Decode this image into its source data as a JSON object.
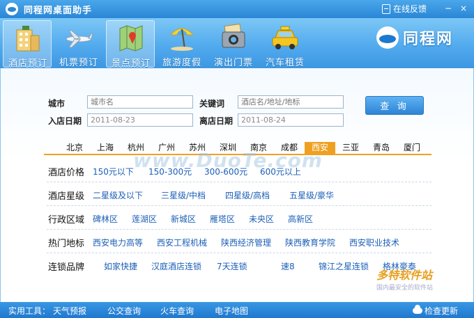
{
  "titlebar": {
    "title": "同程网桌面助手",
    "feedback": "在线反馈",
    "minimize": "−",
    "close": "×"
  },
  "toolbar": {
    "items": [
      {
        "label": "酒店预订",
        "icon": "hotel-icon",
        "active": true
      },
      {
        "label": "机票预订",
        "icon": "airplane-icon",
        "active": false
      },
      {
        "label": "景点预订",
        "icon": "map-icon",
        "active": false
      },
      {
        "label": "旅游度假",
        "icon": "beach-umbrella-icon",
        "active": false
      },
      {
        "label": "演出门票",
        "icon": "camera-ticket-icon",
        "active": false
      },
      {
        "label": "汽车租赁",
        "icon": "taxi-icon",
        "active": false
      }
    ],
    "brand": "同程网"
  },
  "search": {
    "city_label": "城市",
    "city_placeholder": "城市名",
    "keyword_label": "关键词",
    "keyword_placeholder": "酒店名/地址/地标",
    "checkin_label": "入店日期",
    "checkin_value": "2011-08-23",
    "checkout_label": "离店日期",
    "checkout_value": "2011-08-24",
    "button": "查 询"
  },
  "cities": [
    "北京",
    "上海",
    "杭州",
    "广州",
    "苏州",
    "深圳",
    "南京",
    "成都",
    "西安",
    "三亚",
    "青岛",
    "厦门"
  ],
  "active_city": "西安",
  "filters": [
    {
      "title": "酒店价格",
      "options": [
        "150元以下",
        "150-300元",
        "300-600元",
        "600元以上"
      ]
    },
    {
      "title": "酒店星级",
      "options": [
        "二星级及以下",
        "三星级/中档",
        "四星级/高档",
        "五星级/豪华"
      ]
    },
    {
      "title": "行政区域",
      "options": [
        "碑林区",
        "莲湖区",
        "新城区",
        "雁塔区",
        "未央区",
        "高新区"
      ]
    },
    {
      "title": "热门地标",
      "options": [
        "西安电力高等",
        "西安工程机械",
        "陕西经济管理",
        "陕西教育学院",
        "西安职业技术"
      ]
    },
    {
      "title": "连锁品牌",
      "options": [
        "如家快捷",
        "汉庭酒店连锁",
        "7天连锁",
        "速8",
        "锦江之星连锁",
        "格林豪泰"
      ]
    }
  ],
  "watermark": "www.DuoTe.com",
  "footer": {
    "tools_label": "实用工具：",
    "tools": [
      "天气预报",
      "公交查询",
      "火车查询",
      "电子地图"
    ],
    "update": "检查更新"
  },
  "corner_watermark": {
    "line1": "多特软件站",
    "line2": "国内最安全的软件站"
  },
  "colors": {
    "accent": "#2a86d6",
    "city_active": "#f0a020",
    "link": "#1b5fb8"
  }
}
